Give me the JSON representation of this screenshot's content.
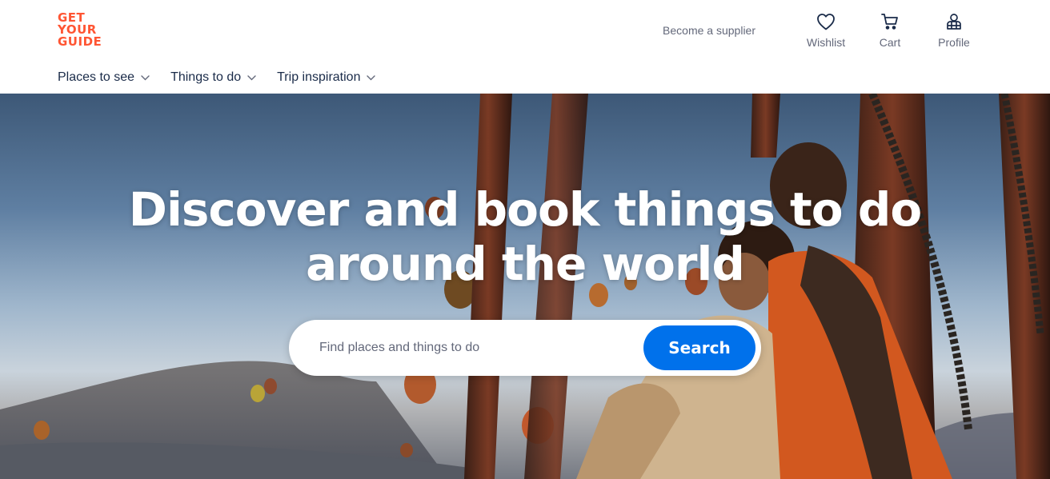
{
  "brand": {
    "logo_lines": [
      "GET",
      "YOUR",
      "GUIDE"
    ],
    "accent_color": "#ff5533"
  },
  "header": {
    "supplier_link": "Become a supplier",
    "actions": [
      {
        "label": "Wishlist",
        "icon": "heart-icon"
      },
      {
        "label": "Cart",
        "icon": "cart-icon"
      },
      {
        "label": "Profile",
        "icon": "profile-icon"
      }
    ]
  },
  "nav": {
    "items": [
      {
        "label": "Places to see",
        "icon": "chevron-down-icon"
      },
      {
        "label": "Things to do",
        "icon": "chevron-down-icon"
      },
      {
        "label": "Trip inspiration",
        "icon": "chevron-down-icon"
      }
    ]
  },
  "hero": {
    "title_line1": "Discover and book things to do",
    "title_line2": "around the world",
    "image_subject": "hot-air-balloons-photo"
  },
  "search": {
    "placeholder": "Find places and things to do",
    "value": "",
    "button_label": "Search",
    "button_color": "#0071eb"
  }
}
